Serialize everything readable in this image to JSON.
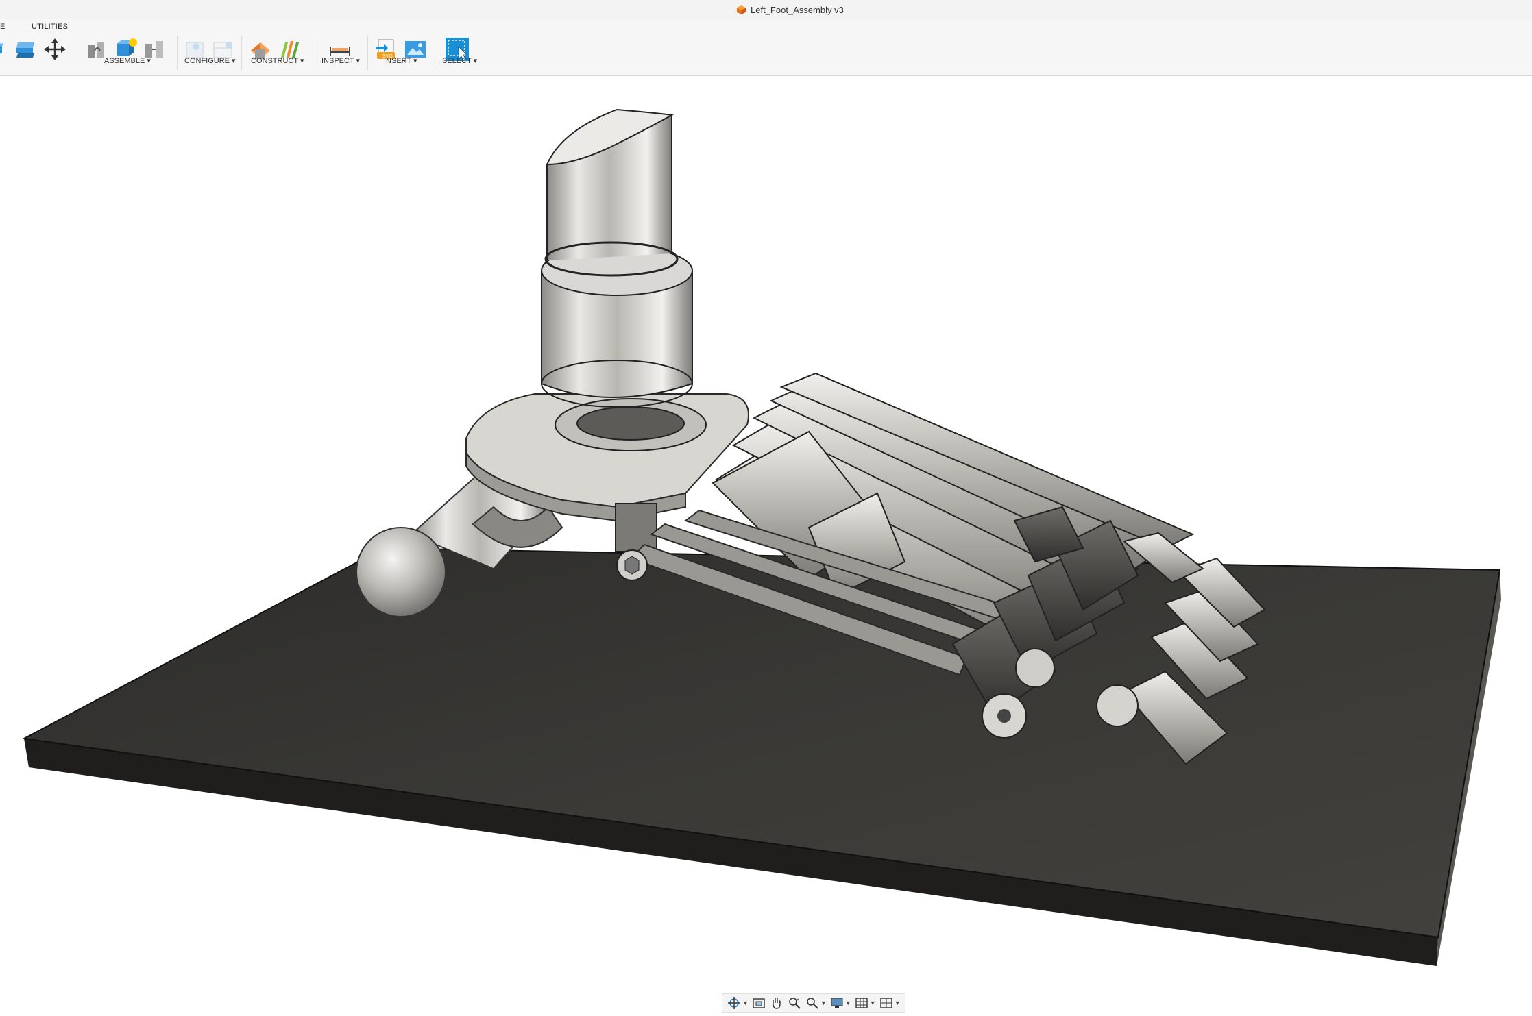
{
  "window": {
    "title": "Left_Foot_Assembly v3",
    "title_icon": "orange-cube-icon"
  },
  "toolbar": {
    "tab_stub": "E",
    "tab": "UTILITIES",
    "groups": {
      "assemble": "ASSEMBLE ▾",
      "configure": "CONFIGURE ▾",
      "construct": "CONSTRUCT ▾",
      "inspect": "INSPECT ▾",
      "insert": "INSERT ▾",
      "select": "SELECT ▾"
    }
  },
  "navbar": {
    "items": [
      "orbit-icon",
      "look-at-icon",
      "pan-icon",
      "zoom-window-icon",
      "zoom-icon",
      "display-settings-icon",
      "grid-icon",
      "viewports-icon"
    ]
  },
  "colors": {
    "accent_blue": "#1a8fd6",
    "plate": "#363532",
    "metal": "#c9c7c2",
    "dark_metal": "#4a4844"
  }
}
